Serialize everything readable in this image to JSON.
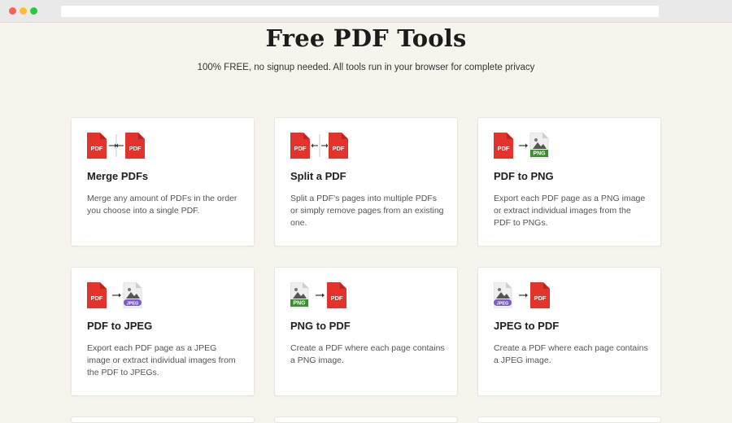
{
  "page": {
    "title": "Free PDF Tools",
    "subtitle": "100% FREE, no signup needed. All tools run in your browser for complete privacy"
  },
  "tools": [
    {
      "title": "Merge PDFs",
      "description": "Merge any amount of PDFs in the order you choose into a single PDF.",
      "from": "PDF",
      "to": "PDF",
      "mode": "merge"
    },
    {
      "title": "Split a PDF",
      "description": "Split a PDF's pages into multiple PDFs or simply remove pages from an existing one.",
      "from": "PDF",
      "to": "PDF",
      "mode": "split"
    },
    {
      "title": "PDF to PNG",
      "description": "Export each PDF page as a PNG image or extract individual images from the PDF to PNGs.",
      "from": "PDF",
      "to": "PNG",
      "mode": "convert"
    },
    {
      "title": "PDF to JPEG",
      "description": "Export each PDF page as a JPEG image or extract individual images from the PDF to JPEGs.",
      "from": "PDF",
      "to": "JPEG",
      "mode": "convert"
    },
    {
      "title": "PNG to PDF",
      "description": "Create a PDF where each page contains a PNG image.",
      "from": "PNG",
      "to": "PDF",
      "mode": "convert"
    },
    {
      "title": "JPEG to PDF",
      "description": "Create a PDF where each page contains a JPEG image.",
      "from": "JPEG",
      "to": "PDF",
      "mode": "convert"
    }
  ],
  "colors": {
    "pdf_red": "#e2342d",
    "png_green": "#3c8f2f",
    "jpeg_purple": "#7b5cc4",
    "page_bg": "#f7f4ee"
  }
}
